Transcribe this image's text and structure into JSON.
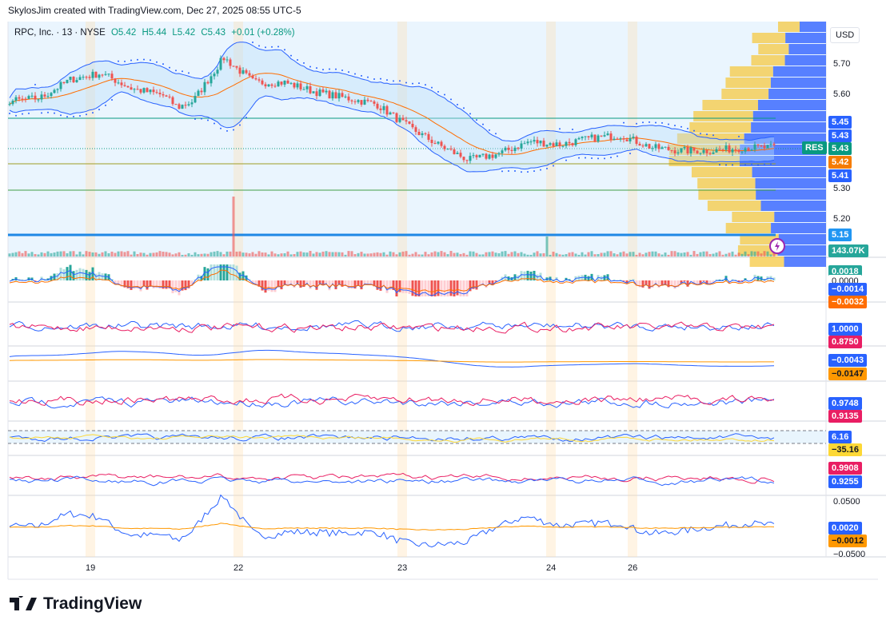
{
  "credit": "SkylosJim created with TradingView.com, Dec 27, 2025 08:55 UTC-5",
  "legend": {
    "symbol": "RPC, Inc. · 13 · NYSE",
    "open": "O5.42",
    "high": "H5.44",
    "low": "L5.42",
    "close": "C5.43",
    "change": "+0.01 (+0.28%)"
  },
  "currency": "USD",
  "price_axis": [
    "5.70",
    "5.60",
    "5.30",
    "5.20"
  ],
  "price_badges": [
    {
      "text": "5.45",
      "color": "#2962ff"
    },
    {
      "text": "5.43",
      "color": "#2962ff"
    },
    {
      "text": "5.43",
      "color": "#089981"
    },
    {
      "text": "5.42",
      "color": "#f57c00"
    },
    {
      "text": "5.41",
      "color": "#2962ff"
    },
    {
      "text": "5.15",
      "color": "#2196f3"
    },
    {
      "text": "143.07K",
      "color": "#26a69a"
    }
  ],
  "res_label": "RES",
  "indicator_badges": [
    {
      "text": "0.0018",
      "color": "#26a69a"
    },
    {
      "text": "0.0000",
      "color": "#ffffff"
    },
    {
      "text": "−0.0014",
      "color": "#2962ff"
    },
    {
      "text": "−0.0032",
      "color": "#ff6d00"
    },
    {
      "text": "1.0000",
      "color": "#2962ff"
    },
    {
      "text": "0.8750",
      "color": "#e91e63"
    },
    {
      "text": "−0.0043",
      "color": "#2962ff"
    },
    {
      "text": "−0.0147",
      "color": "#ff9800"
    },
    {
      "text": "0.9748",
      "color": "#2962ff"
    },
    {
      "text": "0.9135",
      "color": "#e91e63"
    },
    {
      "text": "6.16",
      "color": "#2962ff"
    },
    {
      "text": "−35.16",
      "color": "#fdd835"
    },
    {
      "text": "0.9908",
      "color": "#e91e63"
    },
    {
      "text": "0.9255",
      "color": "#2962ff"
    },
    {
      "text": "0.0020",
      "color": "#2962ff"
    },
    {
      "text": "−0.0012",
      "color": "#ff9800"
    }
  ],
  "indicator_axis": [
    "0.0500",
    "−0.0500"
  ],
  "x_axis": [
    "19",
    "22",
    "23",
    "24",
    "26"
  ],
  "logo": "TradingView",
  "colors": {
    "up": "#26a69a",
    "down": "#ef5350",
    "bb": "#2962ff",
    "ma": "#ff6d00"
  },
  "chart_data": {
    "type": "line",
    "title": "RPC, Inc. · 13 · NYSE",
    "ylabel": "Price (USD)",
    "ylim": [
      5.1,
      5.78
    ],
    "x": [
      0,
      4,
      8,
      12,
      16,
      20,
      22,
      24,
      28,
      32,
      36,
      40,
      44,
      48,
      52,
      56,
      60,
      64,
      68,
      72,
      76,
      80,
      84,
      88,
      92,
      96,
      100
    ],
    "values": [
      5.58,
      5.59,
      5.65,
      5.67,
      5.62,
      5.6,
      5.56,
      5.58,
      5.72,
      5.64,
      5.64,
      5.61,
      5.59,
      5.57,
      5.5,
      5.44,
      5.39,
      5.41,
      5.45,
      5.44,
      5.46,
      5.47,
      5.43,
      5.42,
      5.42,
      5.43,
      5.43
    ],
    "x_ticks": [
      "19",
      "22",
      "23",
      "24",
      "26"
    ],
    "levels": [
      5.45,
      5.43,
      5.41,
      5.3,
      5.15
    ],
    "last_volume": "143.07K"
  }
}
